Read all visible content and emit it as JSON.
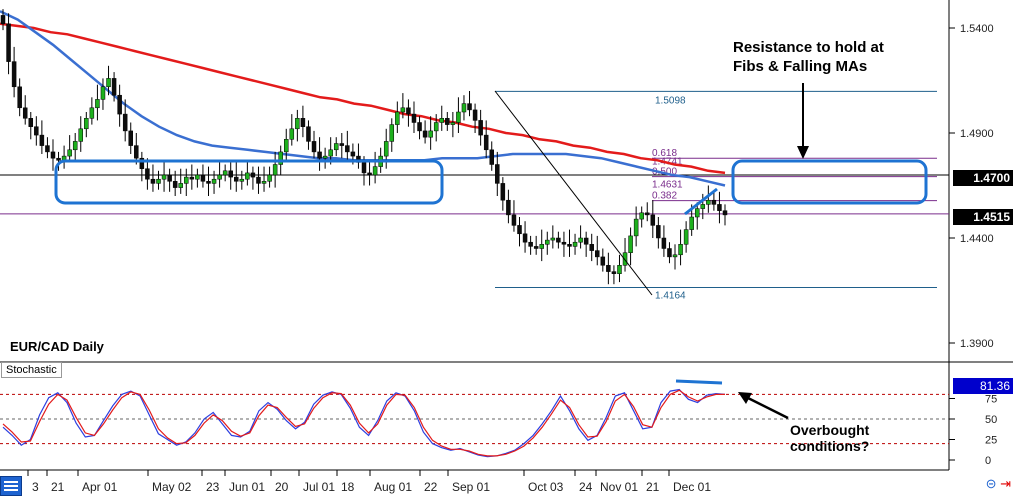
{
  "chart_data": {
    "type": "candlestick",
    "title": "EUR/CAD Daily",
    "instrument": "EUR/CAD",
    "timeframe": "Daily",
    "price_axis": {
      "ticks": [
        "1.5400",
        "1.4900",
        "1.4400",
        "1.3900"
      ],
      "tick_values": [
        1.54,
        1.49,
        1.44,
        1.39
      ],
      "ylim": [
        1.382,
        1.56
      ]
    },
    "x_ticks": [
      "3",
      "21",
      "Apr 01",
      "May 02",
      "23",
      "Jun 01",
      "20",
      "Jul 01",
      "18",
      "Aug 01",
      "22",
      "Sep 01",
      "Oct 03",
      "24",
      "Nov 01",
      "21",
      "Dec 01"
    ],
    "close_series": [
      1.542,
      1.524,
      1.512,
      1.502,
      1.497,
      1.493,
      1.489,
      1.484,
      1.481,
      1.478,
      1.477,
      1.479,
      1.482,
      1.486,
      1.492,
      1.497,
      1.502,
      1.506,
      1.512,
      1.516,
      1.508,
      1.499,
      1.491,
      1.484,
      1.478,
      1.473,
      1.468,
      1.466,
      1.468,
      1.47,
      1.467,
      1.464,
      1.466,
      1.469,
      1.468,
      1.47,
      1.467,
      1.466,
      1.468,
      1.47,
      1.472,
      1.469,
      1.467,
      1.468,
      1.471,
      1.469,
      1.466,
      1.467,
      1.47,
      1.475,
      1.481,
      1.487,
      1.492,
      1.497,
      1.493,
      1.486,
      1.481,
      1.478,
      1.479,
      1.482,
      1.485,
      1.484,
      1.481,
      1.479,
      1.476,
      1.471,
      1.47,
      1.474,
      1.479,
      1.486,
      1.494,
      1.5,
      1.502,
      1.499,
      1.495,
      1.491,
      1.488,
      1.491,
      1.495,
      1.497,
      1.494,
      1.495,
      1.5,
      1.504,
      1.501,
      1.496,
      1.489,
      1.482,
      1.475,
      1.466,
      1.458,
      1.451,
      1.446,
      1.442,
      1.438,
      1.436,
      1.435,
      1.437,
      1.439,
      1.44,
      1.438,
      1.437,
      1.436,
      1.438,
      1.44,
      1.437,
      1.434,
      1.431,
      1.427,
      1.424,
      1.423,
      1.427,
      1.433,
      1.441,
      1.449,
      1.452,
      1.451,
      1.446,
      1.44,
      1.435,
      1.431,
      1.432,
      1.437,
      1.444,
      1.45,
      1.454,
      1.456,
      1.458,
      1.456,
      1.453,
      1.451
    ],
    "moving_averages": [
      {
        "name": "",
        "color": "#e31b1b",
        "values": [
          1.542,
          1.541,
          1.54,
          1.538,
          1.537,
          1.535,
          1.533,
          1.531,
          1.529,
          1.527,
          1.525,
          1.523,
          1.521,
          1.519,
          1.517,
          1.515,
          1.513,
          1.511,
          1.509,
          1.507,
          1.506,
          1.504,
          1.503,
          1.501,
          1.499,
          1.498,
          1.496,
          1.495,
          1.493,
          1.492,
          1.49,
          1.489,
          1.487,
          1.486,
          1.484,
          1.483,
          1.481,
          1.48,
          1.478,
          1.477,
          1.475,
          1.474,
          1.472,
          1.471
        ]
      },
      {
        "name": "",
        "color": "#3a6fd1",
        "values": [
          1.548,
          1.544,
          1.538,
          1.532,
          1.525,
          1.518,
          1.511,
          1.504,
          1.498,
          1.493,
          1.489,
          1.486,
          1.484,
          1.483,
          1.482,
          1.481,
          1.48,
          1.479,
          1.478,
          1.478,
          1.477,
          1.477,
          1.477,
          1.477,
          1.477,
          1.478,
          1.478,
          1.478,
          1.479,
          1.48,
          1.48,
          1.48,
          1.48,
          1.479,
          1.478,
          1.476,
          1.474,
          1.472,
          1.47,
          1.469,
          1.467,
          1.465
        ]
      }
    ],
    "fib_levels": [
      {
        "label": "1.5098",
        "value": 1.5098
      },
      {
        "label": "0.618",
        "value": 1.478
      },
      {
        "label": "1.4741",
        "value": 1.4741
      },
      {
        "label": "0.500",
        "value": 1.4692
      },
      {
        "label": "1.4631",
        "value": 1.4631
      },
      {
        "label": "0.382",
        "value": 1.4578
      },
      {
        "label": "1.4164",
        "value": 1.4164
      }
    ],
    "horizontal_lines": [
      {
        "label": "1.4700",
        "value": 1.47
      },
      {
        "label": "1.4515",
        "value": 1.4515
      }
    ],
    "stochastic": {
      "label": "Stochastic",
      "axis_ticks": [
        "75",
        "50",
        "25",
        "0"
      ],
      "levels": [
        80,
        50,
        20
      ],
      "current_value": "81.36",
      "k_values": [
        40,
        30,
        18,
        25,
        55,
        76,
        82,
        70,
        45,
        28,
        30,
        48,
        66,
        80,
        84,
        78,
        55,
        32,
        25,
        18,
        22,
        33,
        50,
        58,
        44,
        30,
        28,
        35,
        60,
        70,
        62,
        48,
        38,
        46,
        68,
        79,
        83,
        80,
        63,
        40,
        30,
        48,
        72,
        82,
        78,
        60,
        34,
        20,
        15,
        12,
        14,
        10,
        6,
        4,
        5,
        8,
        12,
        20,
        30,
        44,
        60,
        78,
        60,
        38,
        24,
        30,
        52,
        78,
        82,
        60,
        38,
        40,
        70,
        84,
        86,
        74,
        70,
        79,
        81,
        80
      ],
      "d_values": [
        44,
        34,
        22,
        23,
        47,
        68,
        80,
        73,
        52,
        33,
        30,
        44,
        61,
        76,
        83,
        80,
        61,
        38,
        27,
        20,
        21,
        30,
        45,
        55,
        48,
        35,
        29,
        33,
        54,
        67,
        64,
        52,
        41,
        44,
        63,
        76,
        82,
        81,
        67,
        45,
        33,
        44,
        67,
        80,
        79,
        64,
        40,
        24,
        17,
        13,
        13,
        11,
        7,
        5,
        5,
        7,
        11,
        17,
        27,
        40,
        56,
        73,
        64,
        43,
        28,
        29,
        47,
        72,
        80,
        65,
        43,
        40,
        64,
        80,
        85,
        77,
        72,
        77,
        80,
        80
      ]
    },
    "annotations": [
      {
        "text_line1": "Resistance to hold at",
        "text_line2": "Fibs & Falling MAs"
      },
      {
        "text_line1": "Overbought",
        "text_line2": "conditions?"
      }
    ],
    "colors": {
      "bull": "#1db01d",
      "bear": "#0d0d0d",
      "fib": "#7a2d8c",
      "levels": "#1f5f8b",
      "box": "#1e73d2",
      "stoch_k": "#2d3fe0",
      "stoch_d": "#e31b1b"
    },
    "grid": false,
    "legend": "none"
  }
}
